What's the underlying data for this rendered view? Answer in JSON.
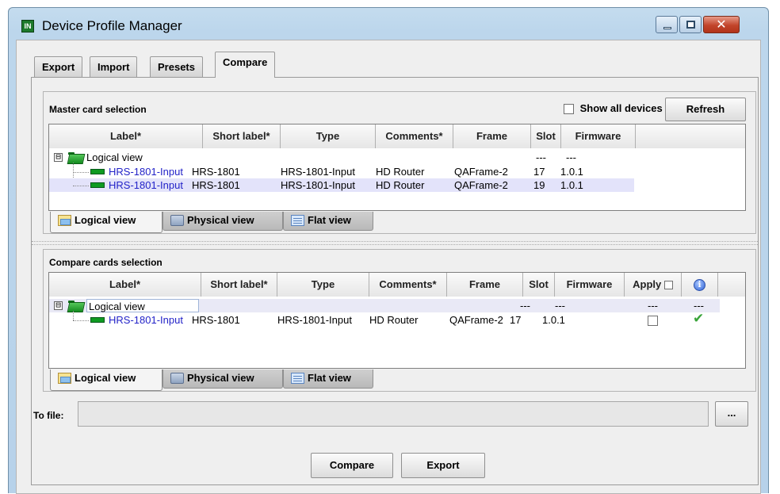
{
  "window": {
    "title": "Device Profile Manager",
    "icon_text": "IN",
    "controls": {
      "minimize": "minimize-icon",
      "maximize": "maximize-icon",
      "close_glyph": "✕"
    }
  },
  "tabs": [
    {
      "label": "Export",
      "active": false
    },
    {
      "label": "Import",
      "active": false
    },
    {
      "label": "Presets",
      "active": false
    },
    {
      "label": "Compare",
      "active": true
    }
  ],
  "master": {
    "title": "Master card selection",
    "show_all_label": "Show all devices",
    "show_all_checked": false,
    "refresh_label": "Refresh",
    "columns": [
      "Label*",
      "Short label*",
      "Type",
      "Comments*",
      "Frame",
      "Slot",
      "Firmware"
    ],
    "root": {
      "label": "Logical view",
      "expander": "⊟",
      "slot": "---",
      "firmware": "---"
    },
    "rows": [
      {
        "label": "HRS-1801-Input",
        "short_label": "HRS-1801",
        "type": "HRS-1801-Input",
        "comments": "HD Router",
        "frame": "QAFrame-2",
        "slot": "17",
        "firmware": "1.0.1",
        "selected": false
      },
      {
        "label": "HRS-1801-Input",
        "short_label": "HRS-1801",
        "type": "HRS-1801-Input",
        "comments": "HD Router",
        "frame": "QAFrame-2",
        "slot": "19",
        "firmware": "1.0.1",
        "selected": true
      }
    ],
    "view_tabs": [
      "Logical view",
      "Physical view",
      "Flat view"
    ]
  },
  "compare": {
    "title": "Compare cards selection",
    "columns": [
      "Label*",
      "Short label*",
      "Type",
      "Comments*",
      "Frame",
      "Slot",
      "Firmware",
      "Apply"
    ],
    "info_glyph": "i",
    "root": {
      "label": "Logical view",
      "expander": "⊟",
      "slot": "---",
      "firmware": "---",
      "apply": "---",
      "status": "---"
    },
    "rows": [
      {
        "label": "HRS-1801-Input",
        "short_label": "HRS-1801",
        "type": "HRS-1801-Input",
        "comments": "HD Router",
        "frame": "QAFrame-2",
        "slot": "17",
        "firmware": "1.0.1",
        "apply": false,
        "status_glyph": "✔"
      }
    ],
    "view_tabs": [
      "Logical view",
      "Physical view",
      "Flat view"
    ]
  },
  "to_file": {
    "label": "To file:",
    "value": "",
    "browse_label": "..."
  },
  "actions": {
    "compare_label": "Compare",
    "export_label": "Export"
  },
  "colors": {
    "link": "#2323c8",
    "selection": "#e3e3fa",
    "check": "#3aa43a",
    "title_gradient": "#bcd6ec"
  }
}
